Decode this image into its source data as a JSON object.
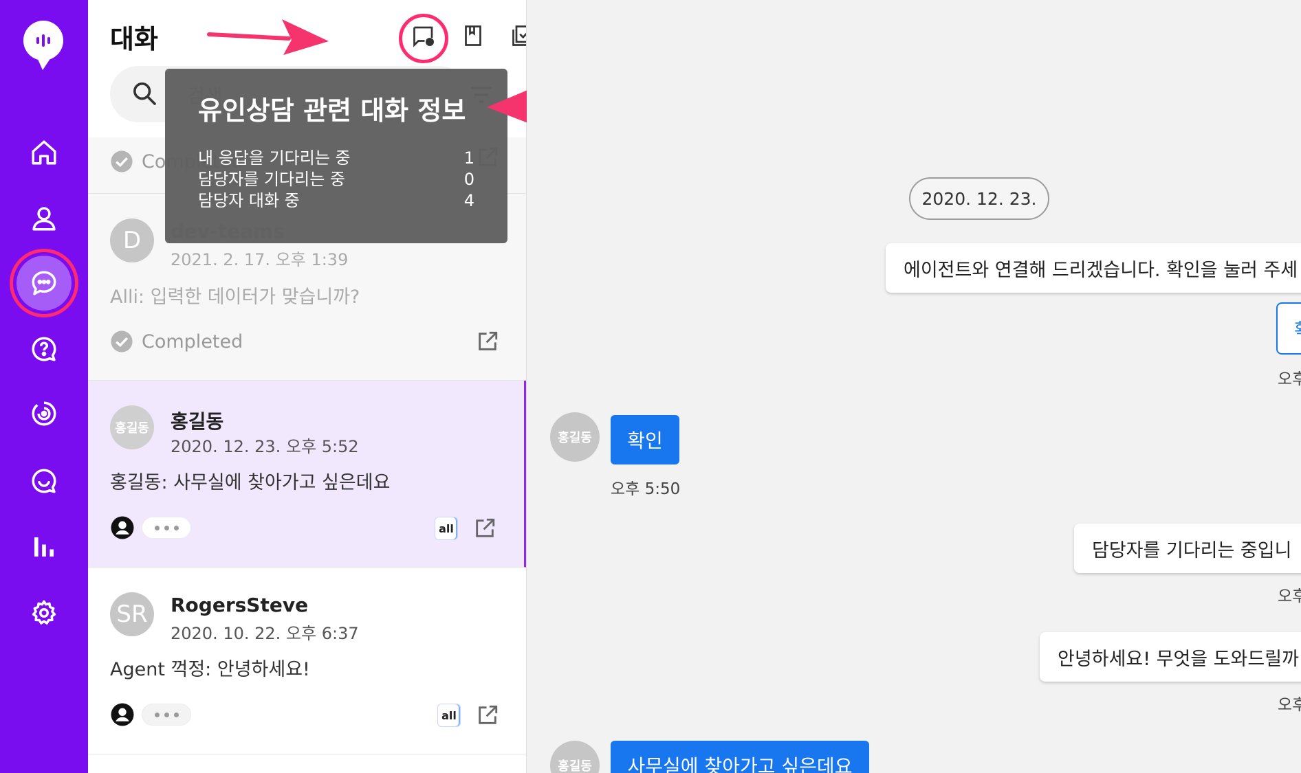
{
  "sidebar": {
    "items": [
      {
        "icon": "home-icon"
      },
      {
        "icon": "user-icon"
      },
      {
        "icon": "chat-icon",
        "active": true
      },
      {
        "icon": "help-icon"
      },
      {
        "icon": "target-icon"
      },
      {
        "icon": "smile-chat-icon"
      },
      {
        "icon": "bar-chart-icon"
      },
      {
        "icon": "settings-icon"
      }
    ],
    "colors": {
      "background": "#7a0cf0",
      "highlight": "#ff2a6f"
    }
  },
  "list": {
    "title": "대화",
    "search_placeholder": "검색",
    "cards": [
      {
        "status": "Completed"
      },
      {
        "avatar_text": "D",
        "name": "dev-teams",
        "date": "2021. 2. 17. 오후 1:39",
        "preview": "Alli: 입력한 데이터가 맞습니까?",
        "status": "Completed"
      },
      {
        "avatar_text": "홍길동",
        "name": "홍길동",
        "date": "2020. 12. 23. 오후 5:52",
        "preview": "홍길동: 사무실에 찾아가고 싶은데요",
        "badge": "all"
      },
      {
        "avatar_text": "SR",
        "name": "RogersSteve",
        "date": "2020. 10. 22. 오후 6:37",
        "preview": "Agent 꺽정: 안녕하세요!",
        "badge": "all"
      }
    ]
  },
  "tooltip": {
    "title": "유인상담 관련 대화 정보",
    "rows": [
      {
        "label": "내 응답을 기다리는 중",
        "value": "1"
      },
      {
        "label": "담당자를 기다리는 중",
        "value": "0"
      },
      {
        "label": "담당자 대화 중",
        "value": "4"
      }
    ]
  },
  "chat": {
    "date": "2020. 12. 23.",
    "messages": [
      {
        "from": "bot",
        "text": "에이전트와 연결해 드리겠습니다. 확인을 눌러 주세"
      },
      {
        "from": "bot-button",
        "text": "확"
      },
      {
        "from": "bot-time",
        "text": "오후"
      },
      {
        "from": "user",
        "text": "확인",
        "time": "오후 5:50"
      },
      {
        "from": "bot",
        "text": "담당자를 기다리는 중입니"
      },
      {
        "from": "bot-time",
        "text": "오후"
      },
      {
        "from": "bot",
        "text": "안녕하세요! 무엇을 도와드릴까"
      },
      {
        "from": "bot-time",
        "text": "오후"
      },
      {
        "from": "user",
        "text": "사무실에 찾아가고 싶은데요"
      }
    ],
    "user_avatar_text": "홍길동",
    "colors": {
      "user_bubble": "#1877ee"
    }
  }
}
